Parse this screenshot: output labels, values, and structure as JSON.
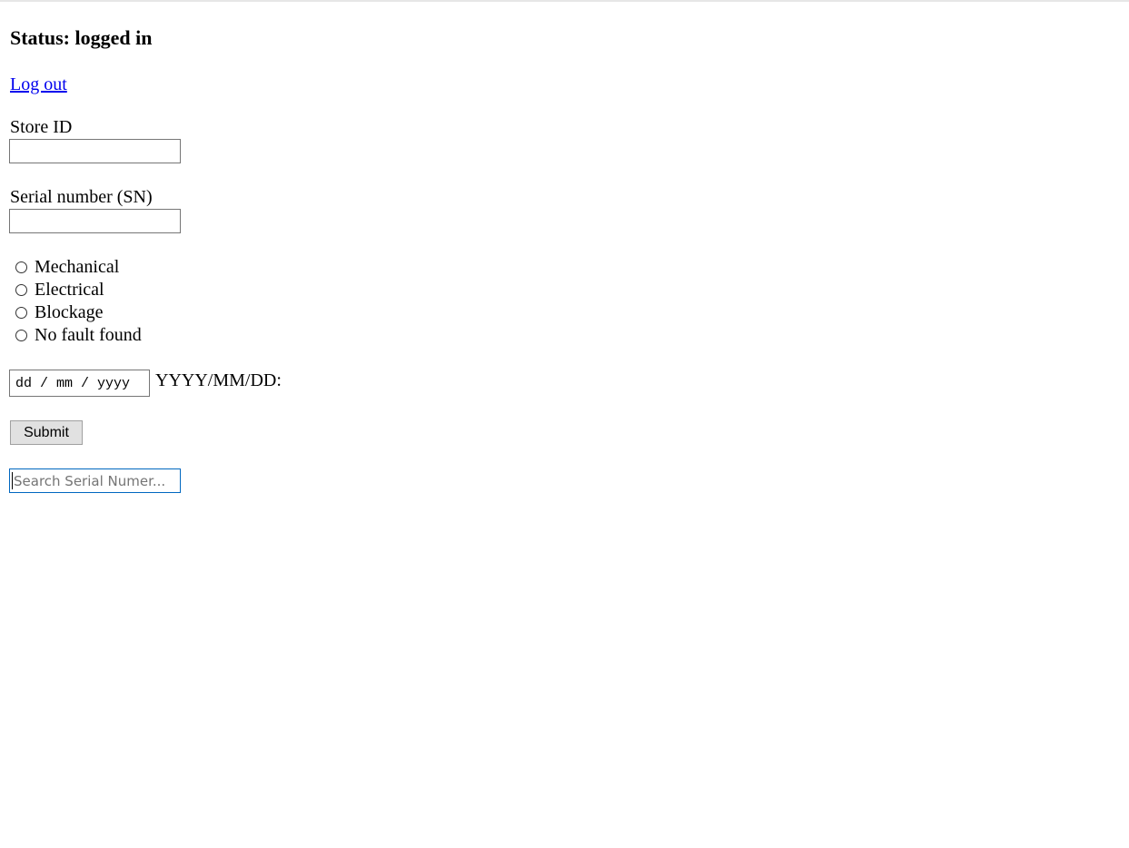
{
  "status": {
    "heading": "Status: logged in"
  },
  "logout_link": "Log out",
  "form": {
    "store_id": {
      "label": "Store ID",
      "value": ""
    },
    "serial_number": {
      "label": "Serial number (SN)",
      "value": ""
    },
    "fault_types": [
      {
        "label": "Mechanical",
        "checked": false
      },
      {
        "label": "Electrical",
        "checked": false
      },
      {
        "label": "Blockage",
        "checked": false
      },
      {
        "label": "No fault found",
        "checked": false
      }
    ],
    "date": {
      "placeholder": "dd / mm / yyyy",
      "label": "YYYY/MM/DD:"
    },
    "submit_label": "Submit"
  },
  "search": {
    "placeholder": "Search Serial Numer...",
    "value": ""
  }
}
